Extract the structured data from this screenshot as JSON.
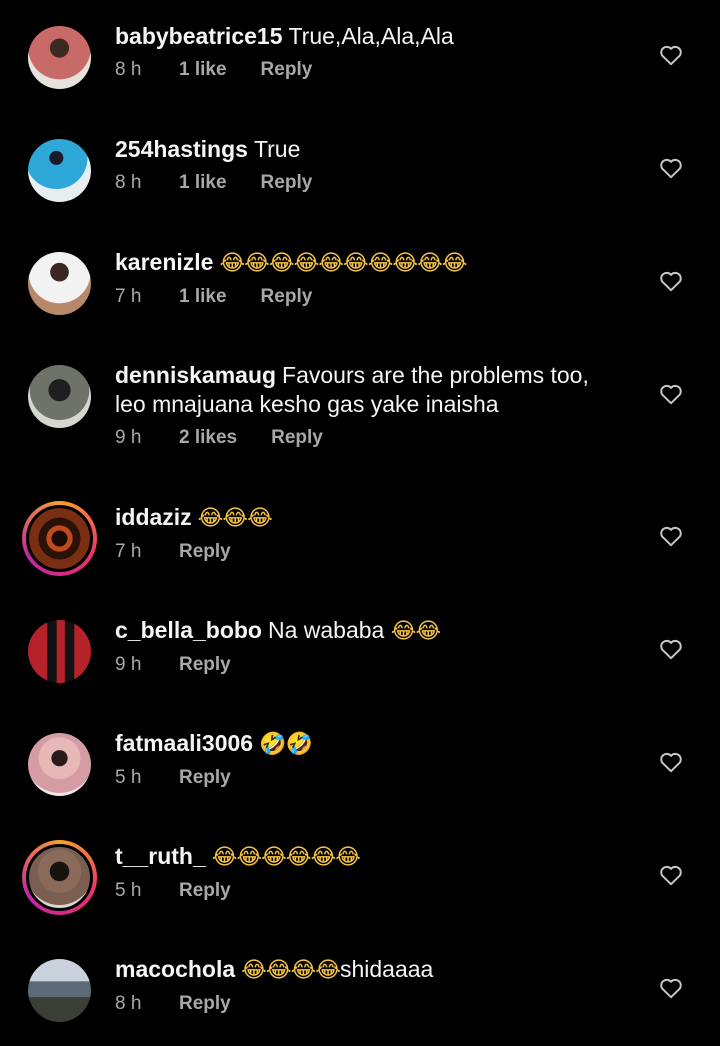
{
  "comments": [
    {
      "username": "babybeatrice15",
      "text": "True,Ala,Ala,Ala",
      "emoji": "",
      "time": "8 h",
      "likes": "1 like",
      "reply": "Reply",
      "avatar_color": "#c86a68",
      "story": false
    },
    {
      "username": "254hastings",
      "text": "True",
      "emoji": "",
      "time": "8 h",
      "likes": "1 like",
      "reply": "Reply",
      "avatar_color": "#2ea8d8",
      "story": false
    },
    {
      "username": "karenizle",
      "text": "",
      "emoji": "😂😂😂😂😂😂😂😂😂😂",
      "time": "7 h",
      "likes": "1 like",
      "reply": "Reply",
      "avatar_color": "#b8886b",
      "story": false
    },
    {
      "username": "denniskamaug",
      "text": "Favours are the problems too,",
      "text2": "leo mnajuana kesho gas yake inaisha",
      "emoji": "",
      "time": "9 h",
      "likes": "2 likes",
      "reply": "Reply",
      "avatar_color": "#6f7268",
      "story": false
    },
    {
      "username": "iddaziz",
      "text": "",
      "emoji": "😂😂😂",
      "time": "7 h",
      "likes": "",
      "reply": "Reply",
      "avatar_color": "#5a1a10",
      "story": true
    },
    {
      "username": "c_bella_bobo",
      "text": "Na wababa",
      "emoji": "😂😂",
      "time": "9 h",
      "likes": "",
      "reply": "Reply",
      "avatar_color": "#b6222a",
      "story": false
    },
    {
      "username": "fatmaali3006",
      "text": "",
      "emoji": "🤣🤣",
      "time": "5 h",
      "likes": "",
      "reply": "Reply",
      "avatar_color": "#d59ca3",
      "story": false
    },
    {
      "username": "t__ruth_",
      "text": "",
      "emoji": "😂😂😂😂😂😂",
      "time": "5 h",
      "likes": "",
      "reply": "Reply",
      "avatar_color": "#7b5e52",
      "story": true
    },
    {
      "username": "macochola",
      "text": "",
      "emoji": "😂😂😂😂",
      "text_after": "shidaaaa",
      "time": "8 h",
      "likes": "",
      "reply": "Reply",
      "avatar_color": "#5c6a78",
      "story": false
    }
  ],
  "icons": {
    "like": "heart-outline-icon"
  },
  "colors": {
    "background": "#000000",
    "text": "#f5f5f5",
    "meta": "#a8a8a8"
  }
}
